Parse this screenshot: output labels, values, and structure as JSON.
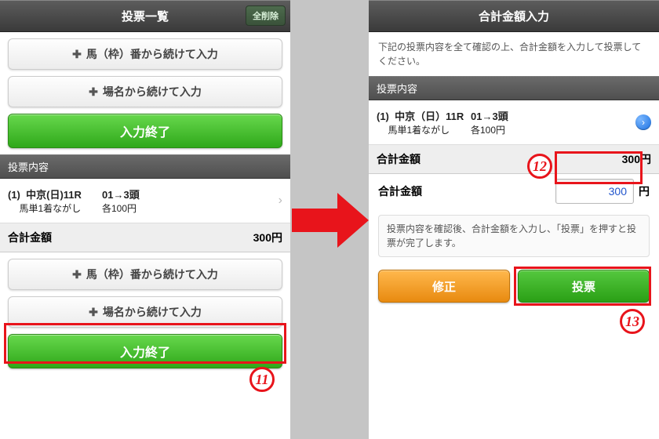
{
  "left": {
    "header_title": "投票一覧",
    "delete_all": "全削除",
    "btn_continue_horse": "馬（枠）番から続けて入力",
    "btn_continue_track": "場名から続けて入力",
    "btn_finish": "入力終了",
    "section_bets": "投票内容",
    "bet": {
      "idx": "(1)",
      "race": "中京(日)11R",
      "type": "馬単1着ながし",
      "sel": "01→3頭",
      "price": "各100円"
    },
    "total_label": "合計金額",
    "total_value": "300円"
  },
  "right": {
    "header_title": "合計金額入力",
    "instr_top": "下記の投票内容を全て確認の上、合計金額を入力して投票してください。",
    "section_bets": "投票内容",
    "bet": {
      "idx": "(1)",
      "race": "中京（日）11R",
      "type": "馬単1着ながし",
      "sel": "01→3頭",
      "price": "各100円"
    },
    "total_label": "合計金額",
    "total_value": "300円",
    "amount_label": "合計金額",
    "amount_value": "300",
    "yen": "円",
    "instr_box": "投票内容を確認後、合計金額を入力し、「投票」を押すと投票が完了します。",
    "btn_modify": "修正",
    "btn_vote": "投票"
  },
  "badges": {
    "b11": "11",
    "b12": "12",
    "b13": "13"
  }
}
